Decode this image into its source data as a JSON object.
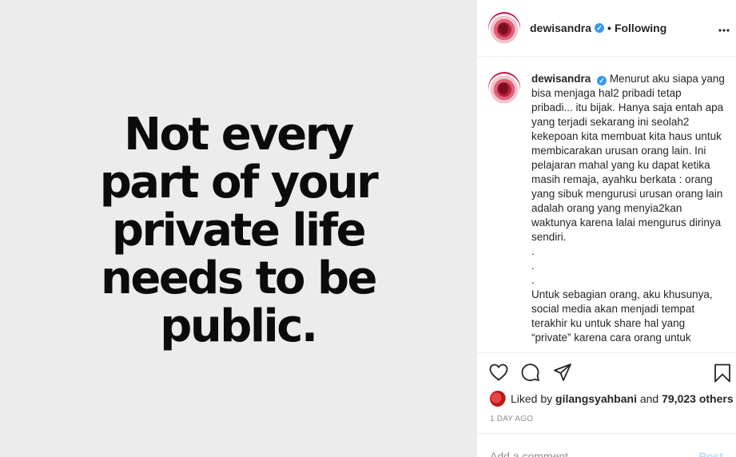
{
  "media": {
    "quote_lines": [
      "Not every",
      "part of your",
      "private life",
      "needs to be",
      "public."
    ]
  },
  "header": {
    "username": "dewisandra",
    "verified_icon": "verified-badge-icon",
    "separator": "•",
    "follow_status": "Following",
    "more_icon": "more-options-icon"
  },
  "caption": {
    "username": "dewisandra",
    "text": "Menurut aku siapa yang bisa menjaga hal2 pribadi tetap pribadi... itu bijak. Hanya saja entah apa yang terjadi sekarang ini seolah2 kekepoan kita membuat kita haus untuk membicarakan urusan orang lain. Ini pelajaran mahal yang ku dapat ketika masih remaja, ayahku berkata : orang yang sibuk mengurusi urusan orang lain adalah orang yang menyia2kan waktunya karena lalai mengurus dirinya sendiri.\n.\n.\n.\nUntuk sebagian orang, aku khusunya, social media akan menjadi tempat terakhir ku untuk share hal yang “private” karena cara orang untuk"
  },
  "actions": {
    "like_icon": "heart-icon",
    "comment_icon": "comment-icon",
    "share_icon": "share-icon",
    "save_icon": "bookmark-icon"
  },
  "likes": {
    "prefix": "Liked by",
    "user": "gilangsyahbani",
    "and": "and",
    "count": "79,023 others"
  },
  "timestamp": "1 DAY AGO",
  "comment_input": {
    "placeholder": "Add a comment...",
    "post_label": "Post"
  },
  "colors": {
    "accent_blue": "#3897f0",
    "post_disabled": "#b2dffc",
    "media_bg": "#ececec"
  }
}
